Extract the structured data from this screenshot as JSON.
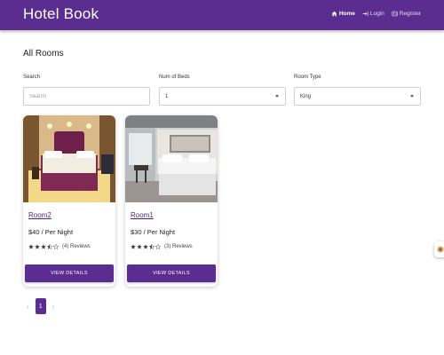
{
  "app": {
    "brand": "Hotel Book"
  },
  "nav": {
    "home": "Home",
    "login": "Login",
    "register": "Register"
  },
  "page": {
    "title": "All Rooms"
  },
  "filters": {
    "search": {
      "label": "Search",
      "placeholder": "Search",
      "value": ""
    },
    "beds": {
      "label": "Num of Beds",
      "value": "1"
    },
    "room_type": {
      "label": "Room Type",
      "value": "King"
    }
  },
  "rooms": [
    {
      "name": "Room2",
      "price": "$40 / Per Night",
      "rating": 3.5,
      "reviews": "(4) Reviews",
      "button": "VIEW DETAILS"
    },
    {
      "name": "Room1",
      "price": "$30 / Per Night",
      "rating": 3.5,
      "reviews": "(3) Reviews",
      "button": "VIEW DETAILS"
    }
  ],
  "pagination": {
    "prev": "‹",
    "current": "1",
    "next": "›"
  },
  "colors": {
    "primary": "#5b2d91",
    "star": "#3d3d3d"
  }
}
